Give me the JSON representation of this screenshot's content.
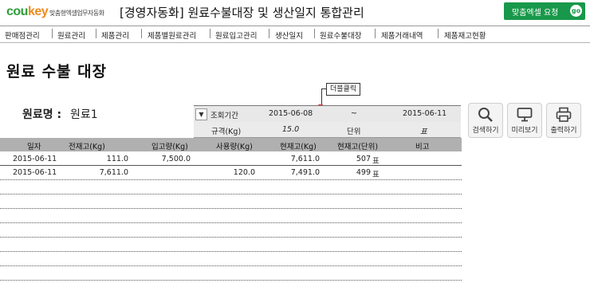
{
  "header": {
    "logo_part1": "cou",
    "logo_part2": "key",
    "tagline": "맞춤형엑셀업무자동화",
    "title": "[경영자동화] 원료수불대장 및 생산일지 통합관리",
    "request_button": "맞춤엑셀 요청",
    "request_go": "go",
    "colors": {
      "brand_green": "#18984a",
      "logo_orange": "#f08a1a",
      "table_header": "#b0b0b0"
    }
  },
  "menu": {
    "items": [
      "판매점관리",
      "원료관리",
      "제품관리",
      "제품별원료관리",
      "원료입고관리",
      "생산일지",
      "원료수불대장",
      "제품거래내역",
      "제품재고현황"
    ]
  },
  "page": {
    "title": "원료 수불 대장",
    "material_label": "원료명 :",
    "material_value": "원료1"
  },
  "tooltip": "더블클릭",
  "filter": {
    "period_label": "조회기간",
    "date_from": "2015-06-08",
    "tilde": "~",
    "date_to": "2015-06-11",
    "spec_label": "규격(Kg)",
    "spec_value": "15.0",
    "unit_label": "단위",
    "unit_value": "표"
  },
  "tools": [
    {
      "label": "검색하기",
      "icon": "search-icon"
    },
    {
      "label": "미리보기",
      "icon": "monitor-icon"
    },
    {
      "label": "출력하기",
      "icon": "printer-icon"
    }
  ],
  "table": {
    "columns": [
      "일자",
      "전재고(Kg)",
      "입고량(Kg)",
      "사용량(Kg)",
      "현재고(Kg)",
      "현재고(단위)",
      "비고"
    ],
    "rows": [
      {
        "date": "2015-06-11",
        "prev_stock": "111.0",
        "in_qty": "7,500.0",
        "use_qty": "",
        "cur_stock": "7,611.0",
        "cur_unit": "507",
        "unit": "표",
        "note": ""
      },
      {
        "date": "2015-06-11",
        "prev_stock": "7,611.0",
        "in_qty": "",
        "use_qty": "120.0",
        "cur_stock": "7,491.0",
        "cur_unit": "499",
        "unit": "표",
        "note": ""
      }
    ]
  }
}
